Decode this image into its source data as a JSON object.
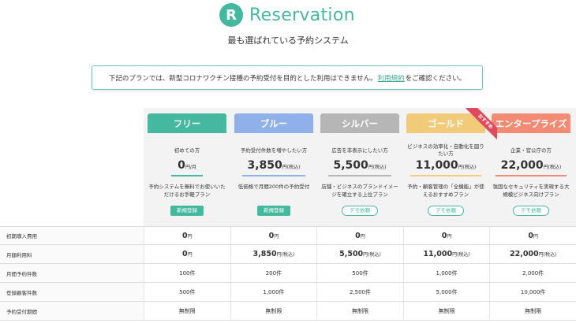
{
  "brand": {
    "mark": "R",
    "name": "Reservation",
    "tagline": "最も選ばれている予約システム",
    "color": "#45b8a0"
  },
  "notice": {
    "before": "下記のプランでは、新型コロナワクチン接種の予約受付を目的とした利用はできません。",
    "link": "利用規約",
    "after": "をご確認ください。"
  },
  "ribbon": "おすすめ",
  "plans": [
    {
      "name": "フリー",
      "color": "#45b8a0",
      "target": "初めての方",
      "price": "0",
      "unit": "円/月",
      "line_color": "#45b8a0",
      "desc": "予約システムを無料でお使いいただけるお手軽プラン",
      "button": "新規登録",
      "button_style": "solid"
    },
    {
      "name": "ブルー",
      "color": "#8fb0e8",
      "target": "予約受付件数を増やしたい方",
      "price": "3,850",
      "unit": "円(税込)",
      "line_color": "#8fb0e8",
      "desc": "低価格で月間200件の予約受付",
      "button": "新規登録",
      "button_style": "solid"
    },
    {
      "name": "シルバー",
      "color": "#b6b6b6",
      "target": "広告を非表示にしたい方",
      "price": "5,500",
      "unit": "円(税込)",
      "line_color": "#b6b6b6",
      "desc": "店舗・ビジネスのブランドイメージを確立する上位プラン",
      "button": "デモ依頼",
      "button_style": "outline"
    },
    {
      "name": "ゴールド",
      "color": "#f2cb7a",
      "target": "ビジネスの効率化・自動化を図りたい方",
      "price": "11,000",
      "unit": "円(税込)",
      "line_color": "#f2cb7a",
      "desc": "予約・顧客管理の「全機能」が使えるおすすめプラン",
      "button": "デモ依頼",
      "button_style": "outline"
    },
    {
      "name": "エンタープライズ",
      "color": "#f28a74",
      "target": "企業・官公庁の方",
      "price": "22,000",
      "unit": "円(税込)",
      "line_color": "#f28a74",
      "desc": "強固なセキュリティを実現する大規模ビジネス向けプラン",
      "button": "デモ依頼",
      "button_style": "outline"
    }
  ],
  "table": [
    {
      "label": "初期導入費用",
      "bold": true,
      "cells": [
        {
          "num": "0",
          "unit": "円"
        },
        {
          "num": "0",
          "unit": "円"
        },
        {
          "num": "0",
          "unit": "円"
        },
        {
          "num": "0",
          "unit": "円"
        },
        {
          "num": "0",
          "unit": "円"
        }
      ]
    },
    {
      "label": "月額利用料",
      "bold": true,
      "cells": [
        {
          "num": "0",
          "unit": "円"
        },
        {
          "num": "3,850",
          "unit": "円(税込)"
        },
        {
          "num": "5,500",
          "unit": "円(税込)"
        },
        {
          "num": "11,000",
          "unit": "円(税込)"
        },
        {
          "num": "22,000",
          "unit": "円(税込)"
        }
      ]
    },
    {
      "label": "月間予約件数",
      "bold": false,
      "cells": [
        {
          "num": "100件",
          "unit": ""
        },
        {
          "num": "200件",
          "unit": ""
        },
        {
          "num": "500件",
          "unit": ""
        },
        {
          "num": "1,000件",
          "unit": ""
        },
        {
          "num": "2,000件",
          "unit": ""
        }
      ]
    },
    {
      "label": "登録顧客件数",
      "bold": false,
      "cells": [
        {
          "num": "500件",
          "unit": ""
        },
        {
          "num": "1,000件",
          "unit": ""
        },
        {
          "num": "2,500件",
          "unit": ""
        },
        {
          "num": "5,000件",
          "unit": ""
        },
        {
          "num": "10,000件",
          "unit": ""
        }
      ]
    },
    {
      "label": "予約受付期間",
      "bold": false,
      "cells": [
        {
          "num": "無制限",
          "unit": ""
        },
        {
          "num": "無制限",
          "unit": ""
        },
        {
          "num": "無制限",
          "unit": ""
        },
        {
          "num": "無制限",
          "unit": ""
        },
        {
          "num": "無制限",
          "unit": ""
        }
      ]
    }
  ]
}
